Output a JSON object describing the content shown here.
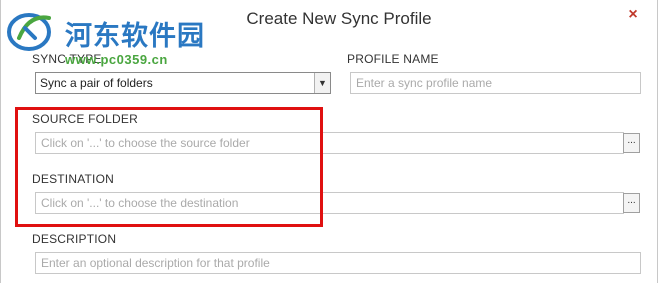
{
  "window": {
    "title": "Create New Sync Profile",
    "close_label": "×"
  },
  "watermark": {
    "site_name_cn": "河东软件园",
    "site_url": "www.pc0359.cn"
  },
  "form": {
    "sync_type": {
      "label": "SYNC TYPE",
      "selected_value": "Sync a pair of folders"
    },
    "profile_name": {
      "label": "PROFILE NAME",
      "placeholder": "Enter a sync profile name"
    },
    "source_folder": {
      "label": "SOURCE FOLDER",
      "placeholder": "Click on '...' to choose the source folder",
      "browse_label": "..."
    },
    "destination": {
      "label": "DESTINATION",
      "placeholder": "Click on '...' to choose the destination",
      "browse_label": "..."
    },
    "description": {
      "label": "DESCRIPTION",
      "placeholder": "Enter an optional description for that profile"
    }
  },
  "colors": {
    "highlight_border": "#e01010",
    "close_icon": "#c0392b",
    "watermark_blue": "#2a78c2",
    "watermark_green": "#4aa640"
  }
}
